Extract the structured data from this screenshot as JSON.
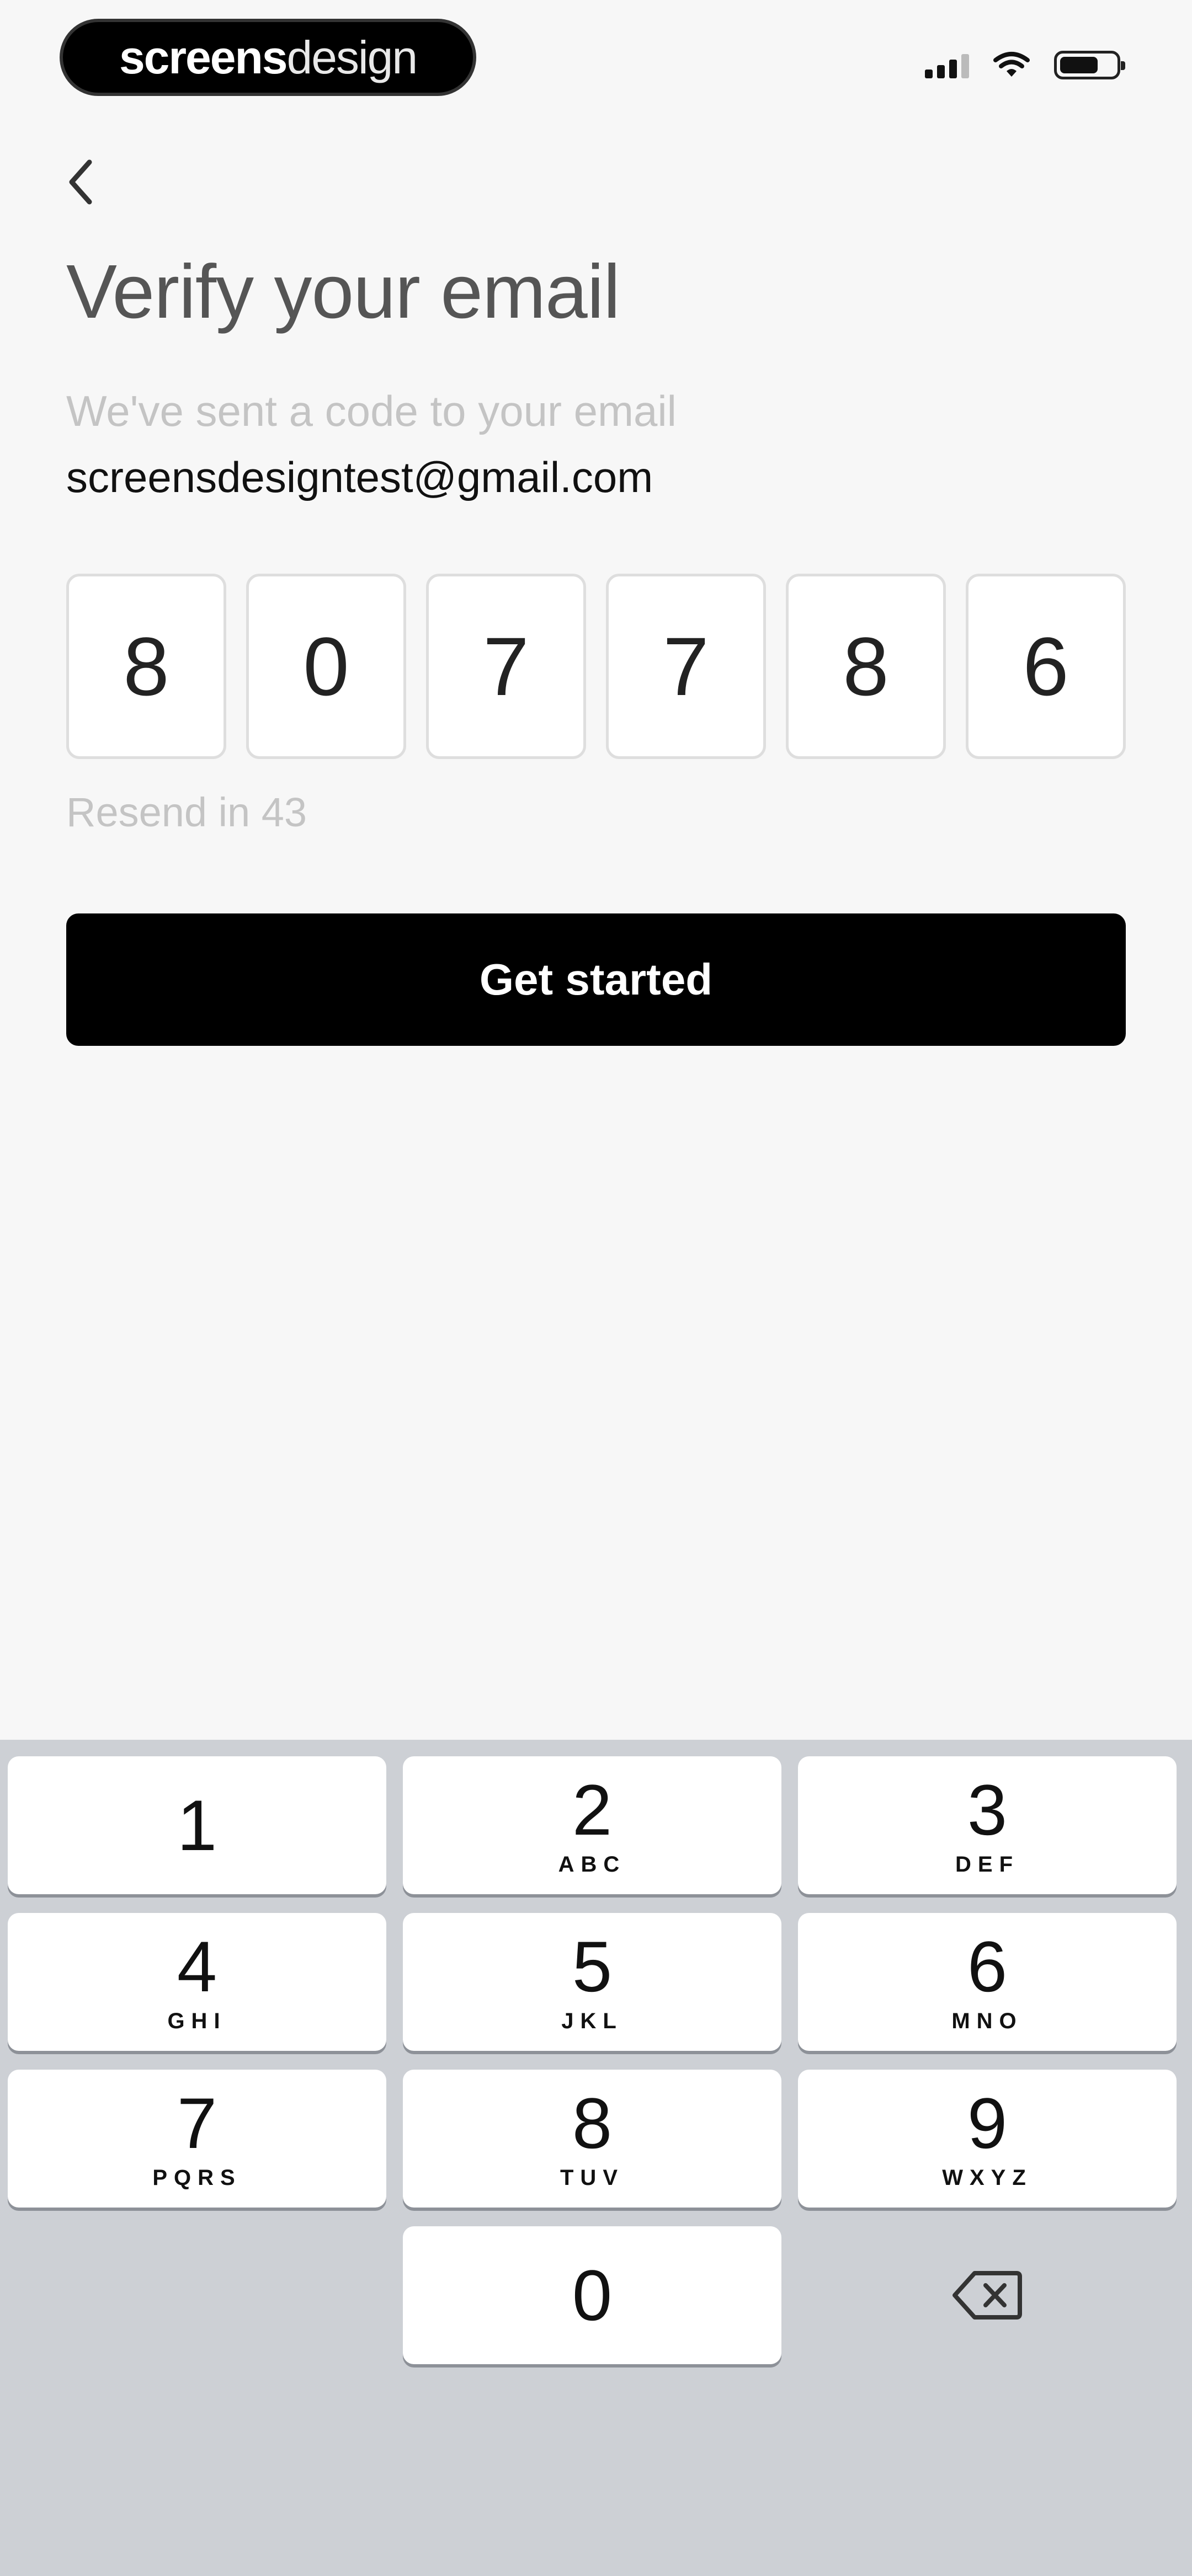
{
  "status_bar": {
    "brand_bold": "screens",
    "brand_light": "design"
  },
  "header": {
    "back_icon": "chevron-left-icon",
    "title": "Verify your email",
    "subtitle": "We've sent a code to your email",
    "email": "screensdesigntest@gmail.com"
  },
  "code": {
    "digits": [
      "8",
      "0",
      "7",
      "7",
      "8",
      "6"
    ],
    "resend_text": "Resend in 43"
  },
  "cta": {
    "label": "Get started",
    "color": "#000000"
  },
  "keypad": {
    "keys": [
      {
        "num": "1",
        "letters": ""
      },
      {
        "num": "2",
        "letters": "ABC"
      },
      {
        "num": "3",
        "letters": "DEF"
      },
      {
        "num": "4",
        "letters": "GHI"
      },
      {
        "num": "5",
        "letters": "JKL"
      },
      {
        "num": "6",
        "letters": "MNO"
      },
      {
        "num": "7",
        "letters": "PQRS"
      },
      {
        "num": "8",
        "letters": "TUV"
      },
      {
        "num": "9",
        "letters": "WXYZ"
      },
      {
        "num": "0",
        "letters": ""
      }
    ],
    "delete_icon": "backspace-icon",
    "background": "#cdd0d5"
  }
}
